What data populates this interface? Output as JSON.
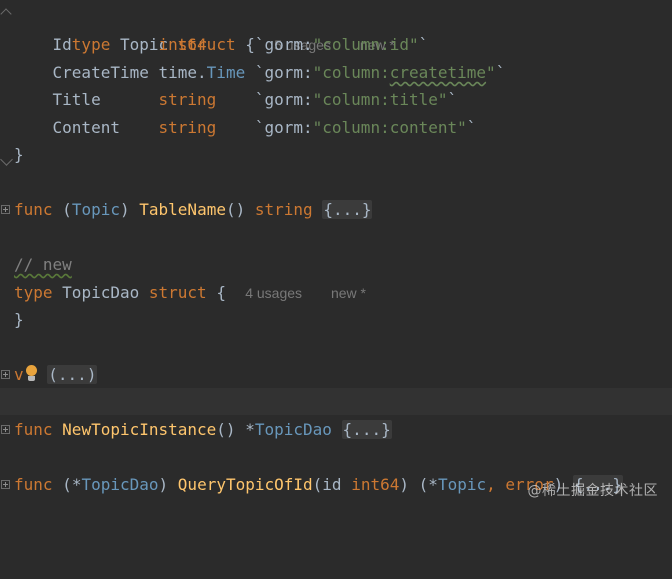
{
  "editor": {
    "struct_topic": {
      "kw_type": "type",
      "name": "Topic",
      "kw_struct": "struct",
      "brace_open": "{",
      "usages_hint": "5 usages",
      "new_hint": "new *",
      "brace_close": "}",
      "fields": [
        {
          "name": "Id",
          "type": "int64",
          "tag_key": "gorm:",
          "tag_value": "\"column:id\""
        },
        {
          "name": "CreateTime",
          "type_pkg": "time",
          "type_dot": ".",
          "type": "Time",
          "tag_key": "gorm:",
          "tag_value_pre": "\"column:",
          "tag_value_word": "createtime",
          "tag_value_post": "\""
        },
        {
          "name": "Title",
          "type": "string",
          "tag_key": "gorm:",
          "tag_value": "\"column:title\""
        },
        {
          "name": "Content",
          "type": "string",
          "tag_key": "gorm:",
          "tag_value": "\"column:content\""
        }
      ],
      "backtick": "`"
    },
    "func_tablename": {
      "kw_func": "func",
      "recv_open": "(",
      "recv_type": "Topic",
      "recv_close": ")",
      "name": "TableName",
      "parens": "()",
      "return_type": "string",
      "folded": "{...}"
    },
    "comment_new": "// new",
    "struct_topicdao": {
      "kw_type": "type",
      "name": "TopicDao",
      "kw_struct": "struct",
      "brace_open": "{",
      "usages_hint": "4 usages",
      "new_hint": "new *",
      "brace_close": "}"
    },
    "var_block": {
      "kw_var_v": "v",
      "folded": "(...)"
    },
    "func_newtopic": {
      "kw_func": "func",
      "name": "NewTopicInstance",
      "parens": "()",
      "ret_star": "*",
      "ret_type": "TopicDao",
      "folded": "{...}"
    },
    "func_query": {
      "kw_func": "func",
      "recv_open": "(",
      "recv_star": "*",
      "recv_type": "TopicDao",
      "recv_close": ")",
      "name": "QueryTopicOfId",
      "param_open": "(",
      "param_name": "id",
      "param_type": "int64",
      "param_close": ")",
      "ret_open": "(",
      "ret_star": "*",
      "ret_type": "Topic",
      "ret_comma": ",",
      "ret_err": "error",
      "ret_close": ")",
      "folded": "{...}"
    }
  },
  "watermark": "@稀土掘金技术社区",
  "colors": {
    "background": "#2b2b2b",
    "keyword": "#cc7832",
    "function": "#ffc66d",
    "string": "#6a8759",
    "type_ref": "#6897bb",
    "comment": "#808080",
    "hint": "#787878",
    "current_line": "#323232"
  },
  "icons": {
    "intention_bulb": "lightbulb-icon",
    "fold_marker": "fold-icon"
  }
}
